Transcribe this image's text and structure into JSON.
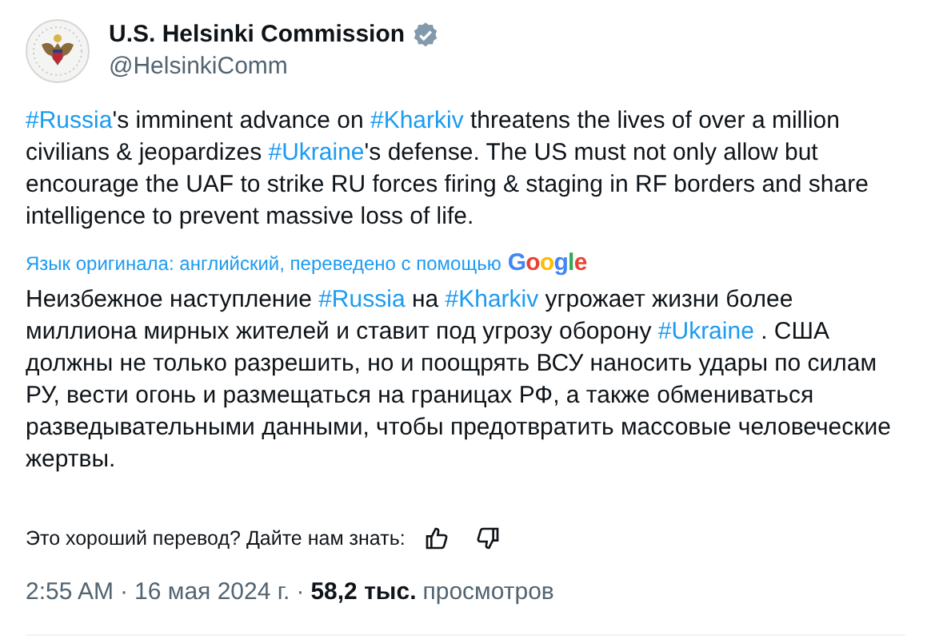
{
  "author": {
    "name": "U.S. Helsinki Commission",
    "verified": true,
    "handle": "@HelsinkiComm"
  },
  "tweet_text": [
    {
      "kind": "hashtag",
      "text": "#Russia"
    },
    {
      "kind": "text",
      "text": "'s imminent advance on "
    },
    {
      "kind": "hashtag",
      "text": "#Kharkiv"
    },
    {
      "kind": "text",
      "text": " threatens the lives of over a million civilians & jeopardizes "
    },
    {
      "kind": "hashtag",
      "text": "#Ukraine"
    },
    {
      "kind": "text",
      "text": "'s defense. The US must not only allow but encourage the UAF to strike RU forces firing & staging in RF borders and share intelligence to prevent massive loss of life."
    }
  ],
  "translation_note": "Язык оригинала: английский, переведено с помощью",
  "translation_provider": "Google",
  "translated_text": [
    {
      "kind": "text",
      "text": "Неизбежное наступление "
    },
    {
      "kind": "hashtag",
      "text": "#Russia"
    },
    {
      "kind": "text",
      "text": " на "
    },
    {
      "kind": "hashtag",
      "text": "#Kharkiv"
    },
    {
      "kind": "text",
      "text": " угрожает жизни более миллиона мирных жителей и ставит под угрозу оборону "
    },
    {
      "kind": "hashtag",
      "text": "#Ukraine"
    },
    {
      "kind": "text",
      "text": " . США должны не только разрешить, но и поощрять ВСУ наносить удары по силам РУ, вести огонь и размещаться на границах РФ, а также обмениваться разведывательными данными, чтобы предотвратить массовые человеческие жертвы."
    }
  ],
  "feedback_prompt": "Это хороший перевод? Дайте нам знать:",
  "meta": {
    "time": "2:55 AM",
    "separators": [
      "·",
      "·"
    ],
    "date": "16 мая 2024 г.",
    "views_count": "58,2 тыс.",
    "views_label": "просмотров"
  }
}
